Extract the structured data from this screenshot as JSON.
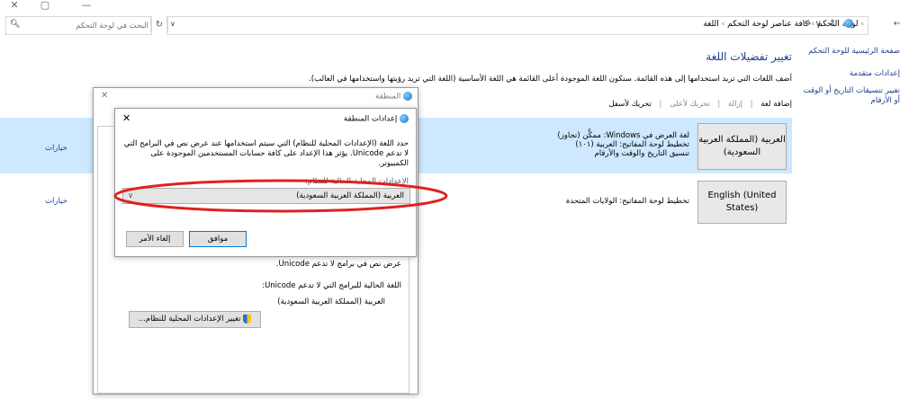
{
  "window": {
    "minimize": "—",
    "maximize": "▢",
    "close": "✕"
  },
  "address": {
    "crumbs": [
      "لوحة التحكم",
      "كافة عناصر لوحة التحكم",
      "اللغة"
    ],
    "separator": "›",
    "search_placeholder": "البحث في لوحة التحكم"
  },
  "sidebar": {
    "items": [
      "صفحة الرئيسية للوحة التحكم",
      "إعدادات متقدمة",
      "تغيير تنسيقات التاريخ أو الوقت أو الأرقام"
    ]
  },
  "main": {
    "title": "تغيير تفضيلات اللغة",
    "description": "أضف اللغات التي تريد استخدامها إلى هذه القائمة. ستكون اللغة الموجودة أعلى القائمة هي اللغة الأساسية (اللغة التي تريد رؤيتها واستخدامها في العالب).",
    "toolbar": {
      "add": "إضافة لغة",
      "remove": "إزالة",
      "move_up": "تحريك لأعلى",
      "move_down": "تحريك لأسفل"
    },
    "languages": [
      {
        "name": "العربية (المملكة العربية السعودية)",
        "details": [
          "لغة العرض في Windows: ممكَّن (تجاوز)",
          "تخطيط لوحة المفاتيح: العربية (١٠١)",
          "تنسيق التاريخ والوقت والأرقام"
        ],
        "options": "خيارات"
      },
      {
        "name": "English (United States)",
        "details": [
          "تخطيط لوحة المفاتيح: الولايات المتحدة"
        ],
        "options": "خيارات"
      }
    ]
  },
  "region_dialog": {
    "title": "المنطقة",
    "close": "✕",
    "text_unicode": "عرض نص في برامج لا تدعم Unicode.",
    "current_label": "اللغة الحالية للبرامج التي لا تدعم Unicode:",
    "current_value": "العربية (المملكة العربية السعودية)",
    "change_button": "تغيير الإعدادات المحلية للنظام..."
  },
  "settings_dialog": {
    "title": "إعدادات المنطقة",
    "close": "✕",
    "description": "حدد اللغة (الإعدادات المحلية للنظام) التي سيتم استخدامها عند عرض نص في البرامج التي لا تدعم Unicode. يؤثر هذا الإعداد على كافة حسابات المستخدمين الموجودة على الكمبيوتر.",
    "field_label": "الإعدادات المحلية الحالية للنظام:",
    "selected_value": "العربية (المملكة العربية السعودية)",
    "ok": "موافق",
    "cancel": "إلغاء الأمر"
  },
  "colors": {
    "link": "#1e3c8c",
    "highlight_row": "#cde8ff",
    "annotation_ellipse": "#e02020"
  }
}
